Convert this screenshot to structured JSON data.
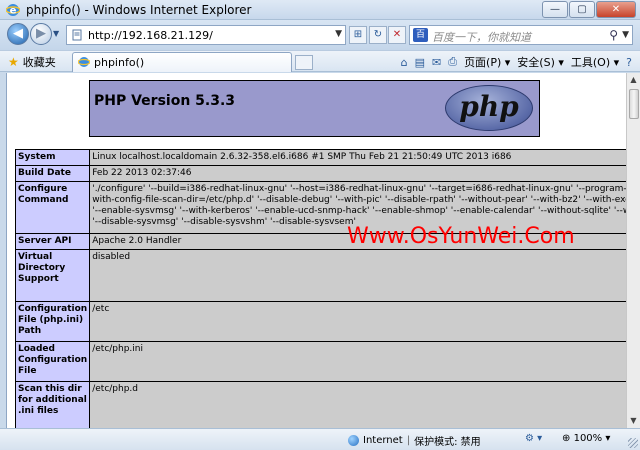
{
  "window": {
    "title": "phpinfo() - Windows Internet Explorer",
    "btn_minimize": "—",
    "btn_maximize": "▢",
    "btn_close": "✕"
  },
  "nav": {
    "back": "◀",
    "forward": "▶",
    "history": "▼",
    "url": "http://192.168.21.129/",
    "compat": "⊞",
    "refresh": "↻",
    "stop": "✕",
    "search_engine": "百",
    "search_placeholder": "百度一下，你就知道",
    "search_glass": "⚲"
  },
  "commandbar": {
    "favorites": "收藏夹",
    "tab_title": "phpinfo()",
    "home": "⌂",
    "feeds": "▤",
    "mail": "✉",
    "print": "⎙",
    "page": "页面(P) ▾",
    "safety": "安全(S) ▾",
    "tools": "工具(O) ▾",
    "help": "?"
  },
  "php": {
    "version_title": "PHP Version 5.3.3",
    "logo_text": "php",
    "rows": [
      {
        "key": "System",
        "value": "Linux localhost.localdomain 2.6.32-358.el6.i686 #1 SMP Thu Feb 21 21:50:49 UTC 2013 i686"
      },
      {
        "key": "Build Date",
        "value": "Feb 22 2013 02:37:46"
      },
      {
        "key": "Configure Command",
        "value": "'./configure' '--build=i386-redhat-linux-gnu' '--host=i386-redhat-linux-gnu' '--target=i686-redhat-linux-gnu' '--program-prefix=' '--prefix=/usr'",
        "value2": "with-config-file-scan-dir=/etc/php.d' '--disable-debug' '--with-pic' '--disable-rpath' '--without-pear' '--with-bz2' '--with-exec-dir=/usr/bin' '--with",
        "value3": "'--enable-sysvmsg' '--with-kerberos' '--enable-ucd-snmp-hack' '--enable-shmop' '--enable-calendar' '--without-sqlite' '--with-libxml-dir=/usr'",
        "value4": "'--disable-sysvmsg' '--disable-sysvshm' '--disable-sysvsem'"
      },
      {
        "key": "Server API",
        "value": "Apache 2.0 Handler"
      },
      {
        "key": "Virtual Directory Support",
        "value": "disabled"
      },
      {
        "key": "Configuration File (php.ini) Path",
        "value": "/etc"
      },
      {
        "key": "Loaded Configuration File",
        "value": "/etc/php.ini"
      },
      {
        "key": "Scan this dir for additional .ini files",
        "value": "/etc/php.d"
      }
    ]
  },
  "watermark": "Www.OsYunWei.Com",
  "status": {
    "zone": "Internet",
    "protected_mode": "保护模式: 禁用",
    "zoom": "100%",
    "zoom_icon": "⊕",
    "zoom_drop": "▾"
  },
  "colors": {
    "php_header": "#9999cc",
    "php_key": "#ccccff",
    "php_value": "#cccccc",
    "watermark": "#ff0000"
  }
}
